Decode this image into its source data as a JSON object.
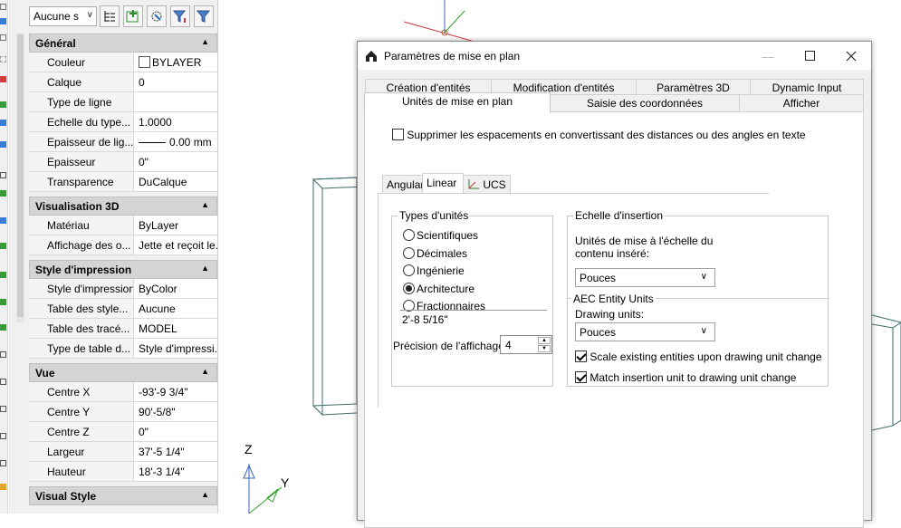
{
  "palette": {
    "selection": "Aucune s",
    "toolbar_icons": [
      "tree-list-icon",
      "select-objects-icon",
      "quick-select-icon",
      "filter-icon",
      "pickadd-filter-icon"
    ],
    "sections": [
      {
        "title": "Général",
        "rows": [
          {
            "label": "Couleur",
            "value": "BYLAYER",
            "swatch": "color"
          },
          {
            "label": "Calque",
            "value": "0"
          },
          {
            "label": "Type de ligne",
            "value": ""
          },
          {
            "label": "Echelle du type...",
            "value": "1.0000"
          },
          {
            "label": "Epaisseur de lig...",
            "value": "0.00 mm",
            "swatch": "line"
          },
          {
            "label": "Epaisseur",
            "value": "0\""
          },
          {
            "label": "Transparence",
            "value": "DuCalque"
          }
        ]
      },
      {
        "title": "Visualisation 3D",
        "rows": [
          {
            "label": "Matériau",
            "value": "ByLayer"
          },
          {
            "label": "Affichage des o...",
            "value": "Jette et reçoit le..."
          }
        ]
      },
      {
        "title": "Style d'impression",
        "rows": [
          {
            "label": "Style d'impression",
            "value": "ByColor"
          },
          {
            "label": "Table des style...",
            "value": "Aucune"
          },
          {
            "label": "Table des tracé...",
            "value": "MODEL"
          },
          {
            "label": "Type de table d...",
            "value": "Style d'impressi..."
          }
        ]
      },
      {
        "title": "Vue",
        "rows": [
          {
            "label": "Centre X",
            "value": "-93'-9 3/4\""
          },
          {
            "label": "Centre Y",
            "value": "90'-5/8\""
          },
          {
            "label": "Centre Z",
            "value": "0\""
          },
          {
            "label": "Largeur",
            "value": "37'-5 1/4\""
          },
          {
            "label": "Hauteur",
            "value": "18'-3 1/4\""
          }
        ]
      },
      {
        "title": "Visual Style",
        "rows": []
      }
    ]
  },
  "canvas": {
    "axis_z": "Z",
    "axis_y": "Y"
  },
  "dialog": {
    "title": "Paramètres de mise en plan",
    "tabs_top": [
      "Création d'entités",
      "Modification d'entités",
      "Paramètres 3D",
      "Dynamic Input"
    ],
    "tabs_bottom": [
      "Unités de mise en plan",
      "Saisie des coordonnées",
      "Afficher"
    ],
    "active_tab": "Unités de mise en plan",
    "suppress_label": "Supprimer les espacements en convertissant des distances ou des angles en texte",
    "subtabs": [
      "Angular",
      "Linear",
      "UCS"
    ],
    "active_subtab": "Linear",
    "unit_types": {
      "legend": "Types d'unités",
      "options": [
        "Scientifiques",
        "Décimales",
        "Ingénierie",
        "Architecture",
        "Fractionnaires"
      ],
      "selected": "Architecture",
      "sample": "2'-8 5/16\""
    },
    "precision": {
      "label": "Précision de l'affichage:",
      "value": "4"
    },
    "insertion_scale": {
      "legend": "Echelle d'insertion",
      "label": "Unités de mise à l'échelle du contenu inséré:",
      "value": "Pouces"
    },
    "aec": {
      "legend": "AEC Entity Units",
      "label": "Drawing units:",
      "value": "Pouces",
      "scale_existing": "Scale existing entities upon drawing unit change",
      "match_insertion": "Match insertion unit to drawing unit change"
    }
  }
}
